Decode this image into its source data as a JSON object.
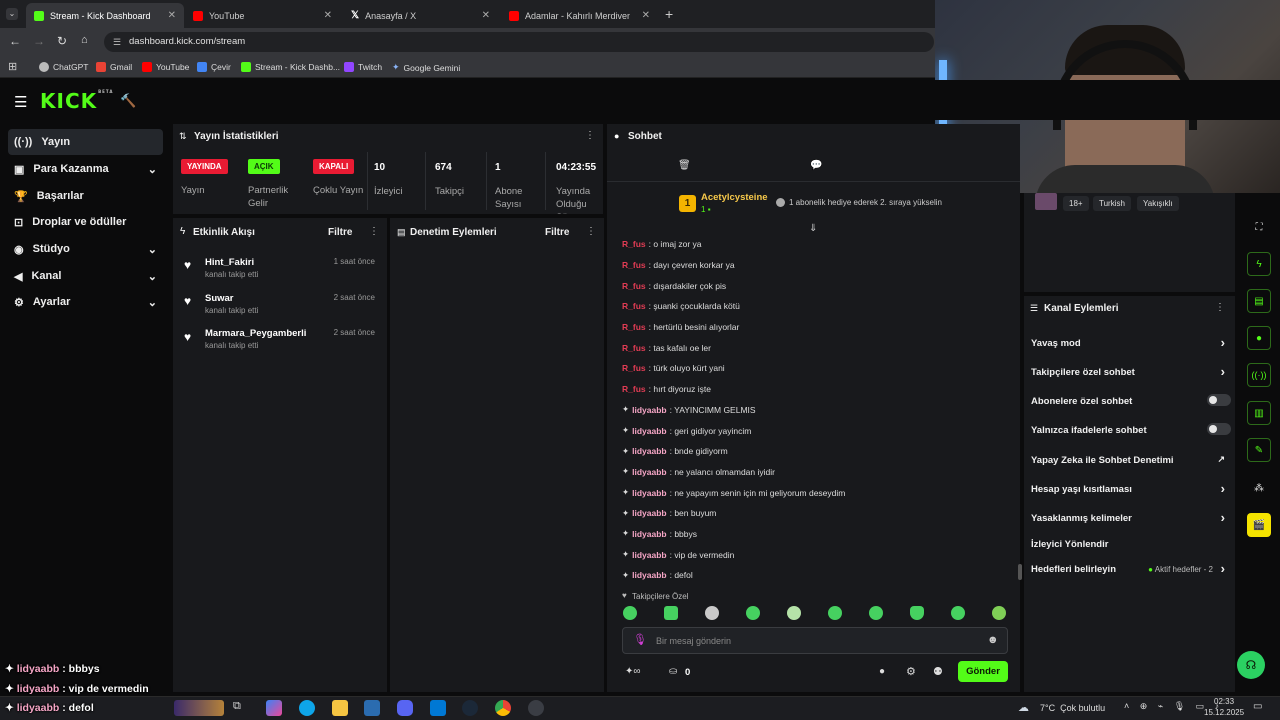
{
  "browser": {
    "tabs": [
      {
        "title": "Stream - Kick Dashboard",
        "active": true,
        "favicon_color": "#53fc18"
      },
      {
        "title": "YouTube",
        "favicon_color": "#ff0000"
      },
      {
        "title": "Anasayfa / X",
        "favicon_color": "#ffffff"
      },
      {
        "title": "Adamlar - Kahırlı Merdiven - Yo",
        "favicon_color": "#ff0000"
      }
    ],
    "url": "dashboard.kick.com/stream",
    "bookmarks": [
      "ChatGPT",
      "Gmail",
      "YouTube",
      "Çevir",
      "Stream - Kick Dashb...",
      "Twitch",
      "Google Gemini"
    ]
  },
  "brand": {
    "logo": "KICK",
    "logo_tag": "BETA",
    "accent": "#53fc18"
  },
  "sidebar": {
    "items": [
      {
        "label": "Yayın",
        "icon": "broadcast-icon",
        "active": true
      },
      {
        "label": "Para Kazanma",
        "icon": "wallet-icon",
        "chevron": true
      },
      {
        "label": "Başarılar",
        "icon": "trophy-icon"
      },
      {
        "label": "Droplar ve ödüller",
        "icon": "gift-icon"
      },
      {
        "label": "Stüdyo",
        "icon": "palette-icon",
        "chevron": true
      },
      {
        "label": "Kanal",
        "icon": "bullhorn-icon",
        "chevron": true
      },
      {
        "label": "Ayarlar",
        "icon": "gear-icon",
        "chevron": true
      }
    ]
  },
  "stats": {
    "title": "Yayın İstatistikleri",
    "items": [
      {
        "value": "YAYINDA",
        "label": "Yayın",
        "badge_color": "#e91b33"
      },
      {
        "value": "AÇIK",
        "label": "Partnerlik Gelir",
        "badge_color": "#53fc18"
      },
      {
        "value": "KAPALI",
        "label": "Çoklu Yayın",
        "badge_color": "#e91b33"
      },
      {
        "value": "10",
        "label": "İzleyici"
      },
      {
        "value": "674",
        "label": "Takipçi"
      },
      {
        "value": "1",
        "label": "Abone Sayısı"
      },
      {
        "value": "04:23:55",
        "label": "Yayında Olduğu Süre"
      }
    ]
  },
  "activity": {
    "title": "Etkinlik Akışı",
    "filter": "Filtre",
    "items": [
      {
        "name": "Hint_Fakiri",
        "sub": "kanalı takip etti",
        "time": "1 saat önce"
      },
      {
        "name": "Suwar",
        "sub": "kanalı takip etti",
        "time": "2 saat önce"
      },
      {
        "name": "Marmara_Peygamberli",
        "sub": "kanalı takip etti",
        "time": "2 saat önce"
      }
    ]
  },
  "moderation": {
    "title": "Denetim Eylemleri",
    "filter": "Filtre"
  },
  "chat": {
    "title": "Sohbet",
    "pinned": {
      "rank": "1",
      "user": "Acetylcysteine",
      "count": "1",
      "text": "1 abonelik hediye ederek 2. sıraya yükselin"
    },
    "messages": [
      {
        "user": "R_fus",
        "text": ": o imaj zor ya",
        "color": "#e23c54",
        "badge": false
      },
      {
        "user": "R_fus",
        "text": ": dayı çevren korkar ya",
        "color": "#e23c54",
        "badge": false
      },
      {
        "user": "R_fus",
        "text": ": dışardakiler çok pis",
        "color": "#e23c54",
        "badge": false
      },
      {
        "user": "R_fus",
        "text": ": şuanki çocuklarda kötü",
        "color": "#e23c54",
        "badge": false
      },
      {
        "user": "R_fus",
        "text": ": hertürlü besini alıyorlar",
        "color": "#e23c54",
        "badge": false
      },
      {
        "user": "R_fus",
        "text": ": tas kafalı oe ler",
        "color": "#e23c54",
        "badge": false
      },
      {
        "user": "R_fus",
        "text": ": türk oluyo kürt yani",
        "color": "#e23c54",
        "badge": false
      },
      {
        "user": "R_fus",
        "text": ": hırt diyoruz işte",
        "color": "#e23c54",
        "badge": false
      },
      {
        "user": "lidyaabb",
        "text": ": YAYINCIMM GELMIS",
        "color": "#f6a6c6",
        "badge": true
      },
      {
        "user": "lidyaabb",
        "text": ": geri gidiyor yayincim",
        "color": "#f6a6c6",
        "badge": true
      },
      {
        "user": "lidyaabb",
        "text": ": bnde gidiyorm",
        "color": "#f6a6c6",
        "badge": true
      },
      {
        "user": "lidyaabb",
        "text": ": ne yalancı olmamdan iyidir",
        "color": "#f6a6c6",
        "badge": true
      },
      {
        "user": "lidyaabb",
        "text": ": ne yapayım senin için mi geliyorum deseydim",
        "color": "#f6a6c6",
        "badge": true
      },
      {
        "user": "lidyaabb",
        "text": ": ben buyum",
        "color": "#f6a6c6",
        "badge": true
      },
      {
        "user": "lidyaabb",
        "text": ": bbbys",
        "color": "#f6a6c6",
        "badge": true
      },
      {
        "user": "lidyaabb",
        "text": ": vip de vermedin",
        "color": "#f6a6c6",
        "badge": true
      },
      {
        "user": "lidyaabb",
        "text": ": defol",
        "color": "#f6a6c6",
        "badge": true
      }
    ],
    "followers_only": "Takipçilere Özel",
    "placeholder": "Bir mesaj gönderin",
    "points_count": "0",
    "send_label": "Gönder"
  },
  "stream_info": {
    "tags": [
      "18+",
      "Turkish",
      "Yakışıklı"
    ]
  },
  "channel_actions": {
    "title": "Kanal Eylemleri",
    "items": [
      {
        "label": "Yavaş mod",
        "control": "chevron"
      },
      {
        "label": "Takipçilere özel sohbet",
        "control": "chevron"
      },
      {
        "label": "Abonelere özel sohbet",
        "control": "toggle"
      },
      {
        "label": "Yalnızca ifadelerle sohbet",
        "control": "toggle"
      },
      {
        "label": "Yapay Zeka ile Sohbet Denetimi",
        "control": "external"
      },
      {
        "label": "Hesap yaşı kısıtlaması",
        "control": "chevron"
      },
      {
        "label": "Yasaklanmış kelimeler",
        "control": "chevron"
      },
      {
        "label": "İzleyici Yönlendir",
        "control": "none"
      },
      {
        "label": "Hedefleri belirleyin",
        "control": "chevron",
        "extra": "Aktif hedefler - 2"
      }
    ]
  },
  "overlay_chat": [
    {
      "user": "lidyaabb",
      "text": " : bbbys"
    },
    {
      "user": "lidyaabb",
      "text": " : vip de vermedin"
    },
    {
      "user": "lidyaabb",
      "text": " : defol"
    }
  ],
  "taskbar": {
    "weather": "7°C  Çok bulutlu",
    "time": "02:33",
    "date": "15.12.2025"
  }
}
